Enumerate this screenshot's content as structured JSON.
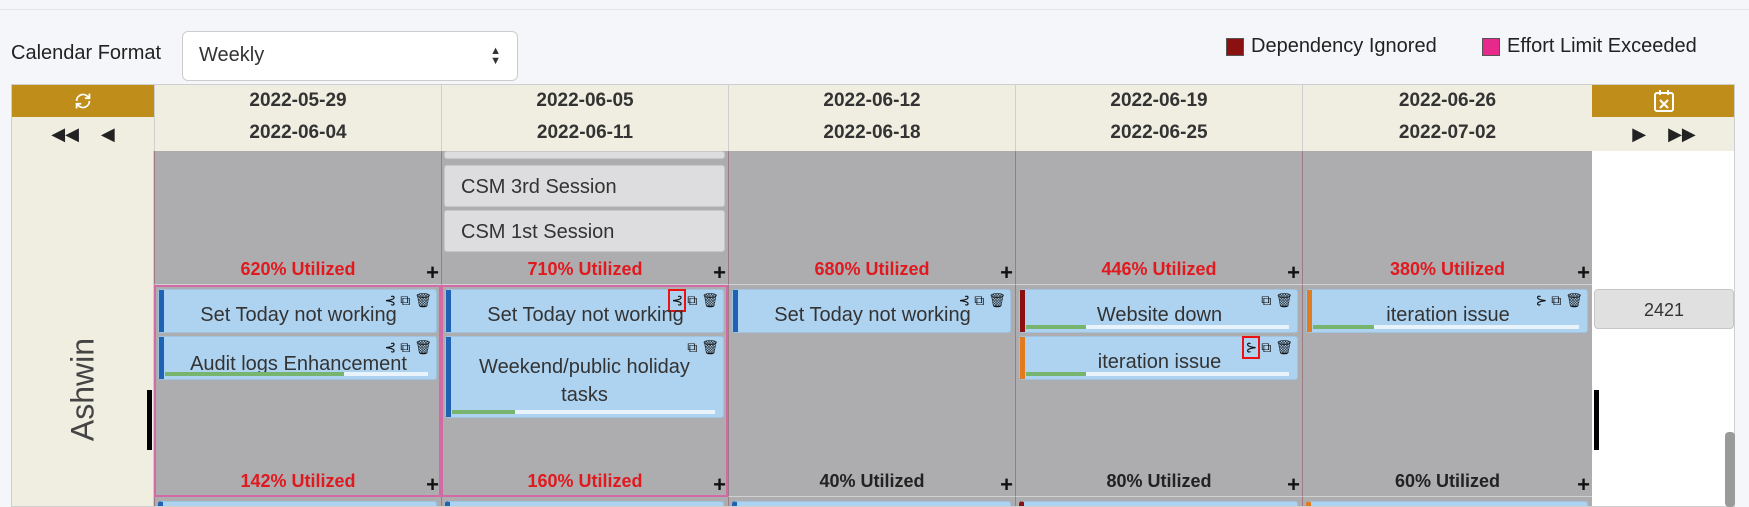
{
  "controls": {
    "calendar_format_label": "Calendar Format",
    "calendar_format_value": "Weekly"
  },
  "legend": [
    {
      "label": "Dependency Ignored",
      "color": "#8b1010"
    },
    {
      "label": "Effort Limit Exceeded",
      "color": "#e8298c"
    }
  ],
  "weeks": [
    {
      "start": "2022-05-29",
      "end": "2022-06-04"
    },
    {
      "start": "2022-06-05",
      "end": "2022-06-11"
    },
    {
      "start": "2022-06-12",
      "end": "2022-06-18"
    },
    {
      "start": "2022-06-19",
      "end": "2022-06-25"
    },
    {
      "start": "2022-06-26",
      "end": "2022-07-02"
    }
  ],
  "row0": {
    "sessions": [
      "CSM 3rd Session",
      "CSM 1st Session"
    ],
    "utilization": [
      "620% Utilized",
      "710% Utilized",
      "680% Utilized",
      "446% Utilized",
      "380% Utilized"
    ]
  },
  "row1": {
    "name": "Ashwin",
    "id": "2421",
    "utilization": [
      "142% Utilized",
      "160% Utilized",
      "40% Utilized",
      "80% Utilized",
      "60% Utilized"
    ],
    "tasks": {
      "w1_t1": "Set Today not working",
      "w1_t2": "Audit logs Enhancement",
      "w2_t1": "Set Today not working",
      "w2_t2": "Weekend/public holiday tasks",
      "w3_t1": "Set Today not working",
      "w4_t1": "Website down",
      "w4_t2": "iteration issue",
      "w5_t1": "iteration issue"
    }
  },
  "icons": [
    "refresh-icon",
    "first-page-icon",
    "prev-page-icon",
    "calendar-clear-icon",
    "next-page-icon",
    "last-page-icon",
    "dependency-icon",
    "copy-icon",
    "delete-icon",
    "add-icon"
  ]
}
